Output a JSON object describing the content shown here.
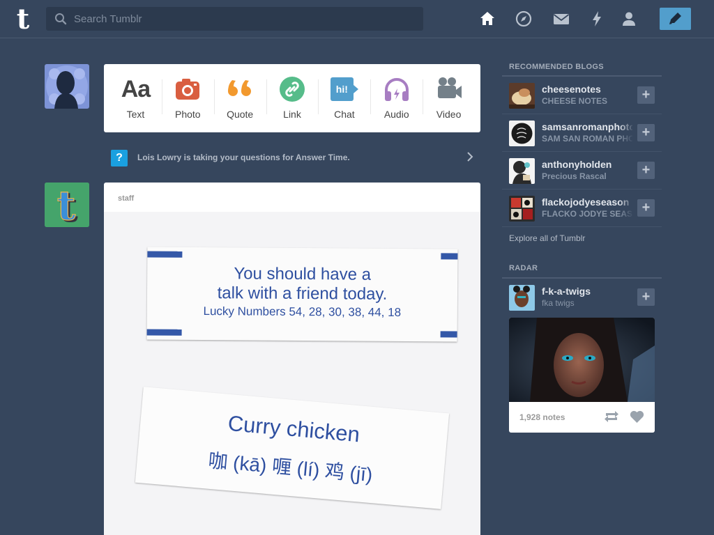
{
  "header": {
    "search_placeholder": "Search Tumblr",
    "nav": [
      "home-icon",
      "explore-icon",
      "inbox-icon",
      "activity-icon",
      "account-icon"
    ],
    "compose_icon": "pencil-icon",
    "accent": "#529ecc"
  },
  "post_types": [
    {
      "label": "Text",
      "icon": "Aa",
      "color": "#444444"
    },
    {
      "label": "Photo",
      "icon": "camera-icon",
      "color": "#d95e40"
    },
    {
      "label": "Quote",
      "icon": "quote-icon",
      "color": "#f2992e"
    },
    {
      "label": "Link",
      "icon": "link-icon",
      "color": "#56bc8a"
    },
    {
      "label": "Chat",
      "icon": "hi!",
      "color": "#529ecc"
    },
    {
      "label": "Audio",
      "icon": "headphones-icon",
      "color": "#a77dc2"
    },
    {
      "label": "Video",
      "icon": "video-camera-icon",
      "color": "#748089"
    }
  ],
  "answer_time": {
    "icon": "?",
    "text": "Lois Lowry is taking your questions for Answer Time."
  },
  "post": {
    "author": "staff",
    "fortune_line1": "You should have a",
    "fortune_line2": "talk with a friend today.",
    "fortune_numbers": "Lucky Numbers  54, 28, 30, 38, 44, 18",
    "food_en": "Curry chicken",
    "food_zh": "咖 (kā) 喱 (lí) 鸡 (jī)"
  },
  "sidebar": {
    "recommended_title": "RECOMMENDED BLOGS",
    "blogs": [
      {
        "name": "cheesenotes",
        "subtitle": "CHEESE NOTES"
      },
      {
        "name": "samsanromanphotos",
        "subtitle": "SAM SAN ROMAN PHOTOS"
      },
      {
        "name": "anthonyholden",
        "subtitle": "Precious Rascal"
      },
      {
        "name": "flackojodyeseason",
        "subtitle": "FLACKO JODYE SEASON"
      }
    ],
    "explore_link": "Explore all of Tumblr",
    "radar_title": "RADAR",
    "radar": {
      "name": "f-k-a-twigs",
      "subtitle": "fka twigs",
      "notes": "1,928 notes"
    }
  }
}
